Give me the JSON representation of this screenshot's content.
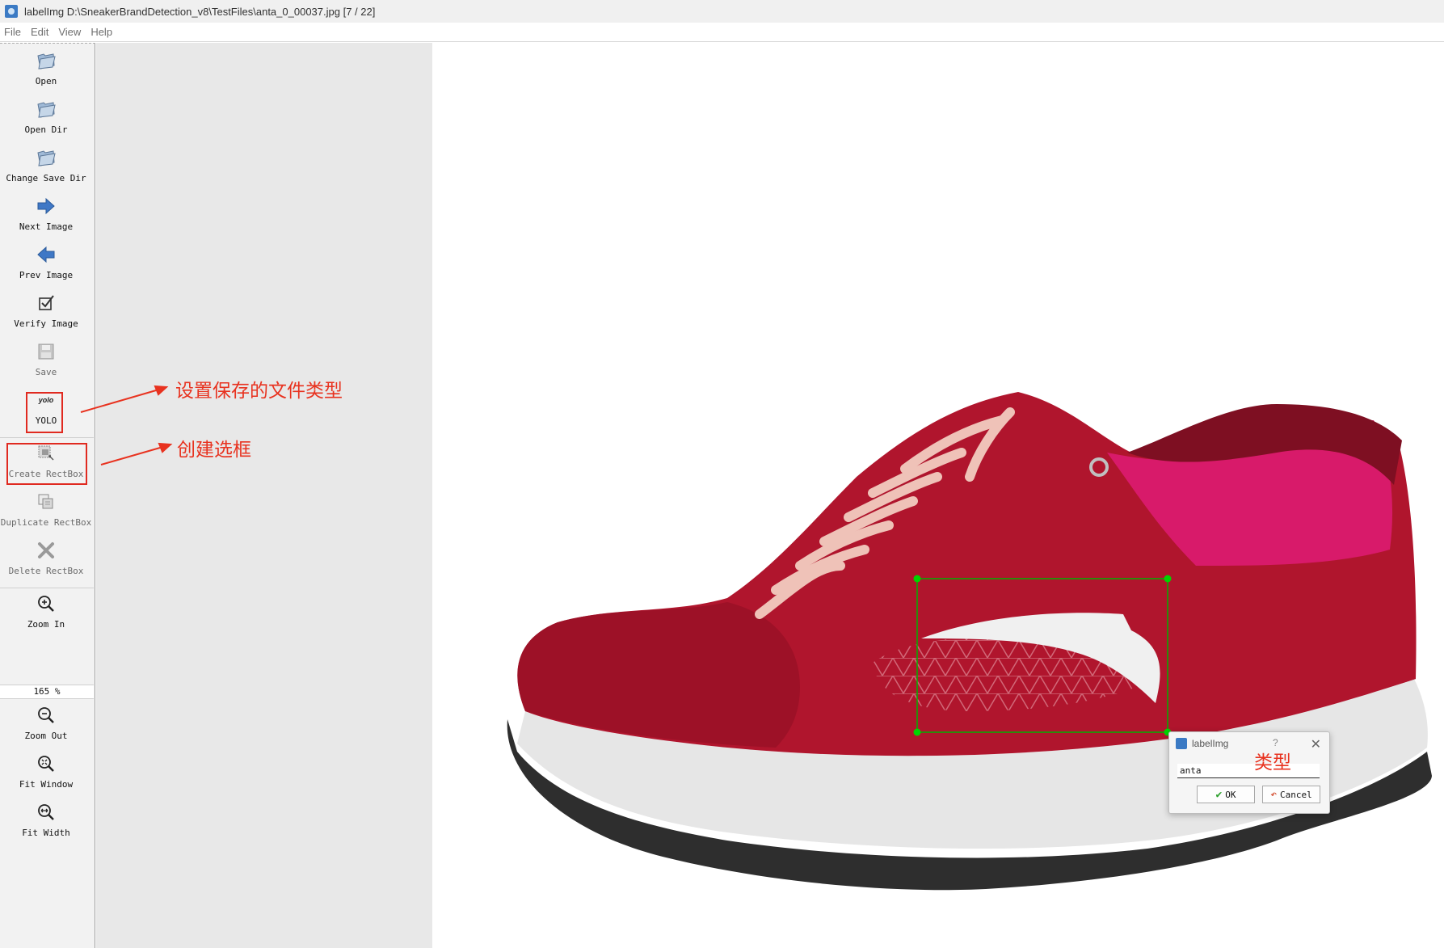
{
  "window": {
    "title": "labelImg D:\\SneakerBrandDetection_v8\\TestFiles\\anta_0_00037.jpg [7 / 22]"
  },
  "menu": [
    "File",
    "Edit",
    "View",
    "Help"
  ],
  "toolbar": {
    "open": "Open",
    "open_dir": "Open Dir",
    "change_save_dir": "Change Save Dir",
    "next_image": "Next Image",
    "prev_image": "Prev Image",
    "verify_image": "Verify Image",
    "save": "Save",
    "format_icon_text": "yolo",
    "format": "YOLO",
    "create_rectbox": "Create RectBox",
    "duplicate_rectbox": "Duplicate RectBox",
    "delete_rectbox": "Delete RectBox",
    "zoom_in": "Zoom In",
    "zoom_value": "165 %",
    "zoom_out": "Zoom Out",
    "fit_window": "Fit Window",
    "fit_width": "Fit Width"
  },
  "annotations": {
    "save_format": "设置保存的文件类型",
    "create_box": "创建选框",
    "label_type": "类型"
  },
  "dialog": {
    "title": "labelImg",
    "help": "?",
    "input_value": "anta",
    "ok": "OK",
    "cancel": "Cancel"
  },
  "colors": {
    "annotation_red": "#e8321f",
    "bbox_green": "#00d400",
    "shoe_red": "#b0152d",
    "shoe_pink": "#d81a6a"
  }
}
